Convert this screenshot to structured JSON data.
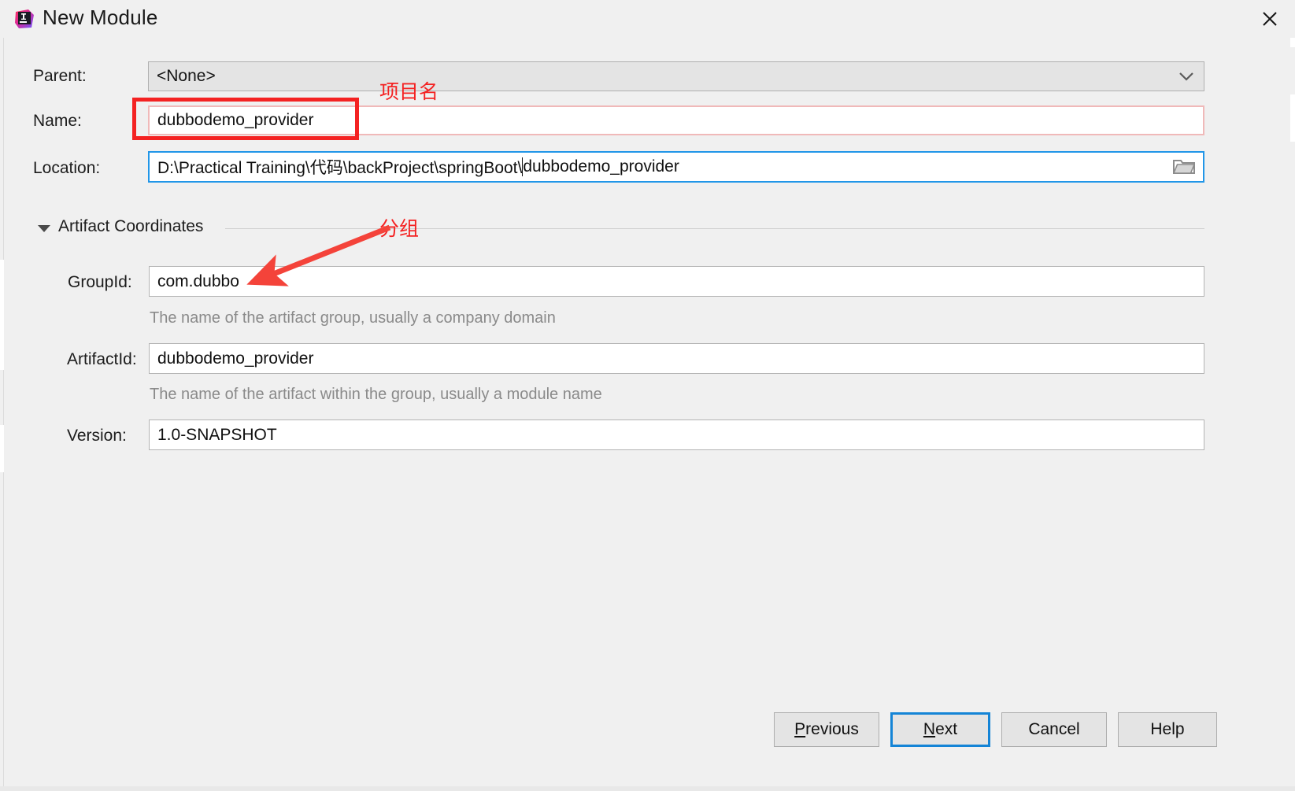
{
  "window": {
    "title": "New Module",
    "logo_icon": "intellij-idea-logo",
    "close_icon": "close-icon"
  },
  "form": {
    "parent": {
      "label": "Parent:",
      "value": "<None>",
      "dropdown_icon": "chevron-down-icon"
    },
    "name": {
      "label": "Name:",
      "value": "dubbodemo_provider"
    },
    "location": {
      "label": "Location:",
      "value_before_caret": "D:\\Practical Training\\代码\\backProject\\springBoot\\",
      "value_after_caret": "dubbodemo_provider",
      "full_value": "D:\\Practical Training\\代码\\backProject\\springBoot\\dubbodemo_provider",
      "browse_icon": "folder-icon"
    }
  },
  "artifact_section": {
    "title": "Artifact Coordinates",
    "collapse_icon": "triangle-down-icon",
    "group_id": {
      "label": "GroupId:",
      "value": "com.dubbo",
      "hint": "The name of the artifact group, usually a company domain"
    },
    "artifact_id": {
      "label": "ArtifactId:",
      "value": "dubbodemo_provider",
      "hint": "The name of the artifact within the group, usually a module name"
    },
    "version": {
      "label": "Version:",
      "value": "1.0-SNAPSHOT"
    }
  },
  "buttons": {
    "previous": {
      "prefix": "",
      "mnemonic": "P",
      "suffix": "revious"
    },
    "next": {
      "prefix": "",
      "mnemonic": "N",
      "suffix": "ext"
    },
    "cancel": "Cancel",
    "help": "Help"
  },
  "annotations": {
    "accent_color": "#f42222",
    "name_label": "项目名",
    "group_label": "分组"
  }
}
